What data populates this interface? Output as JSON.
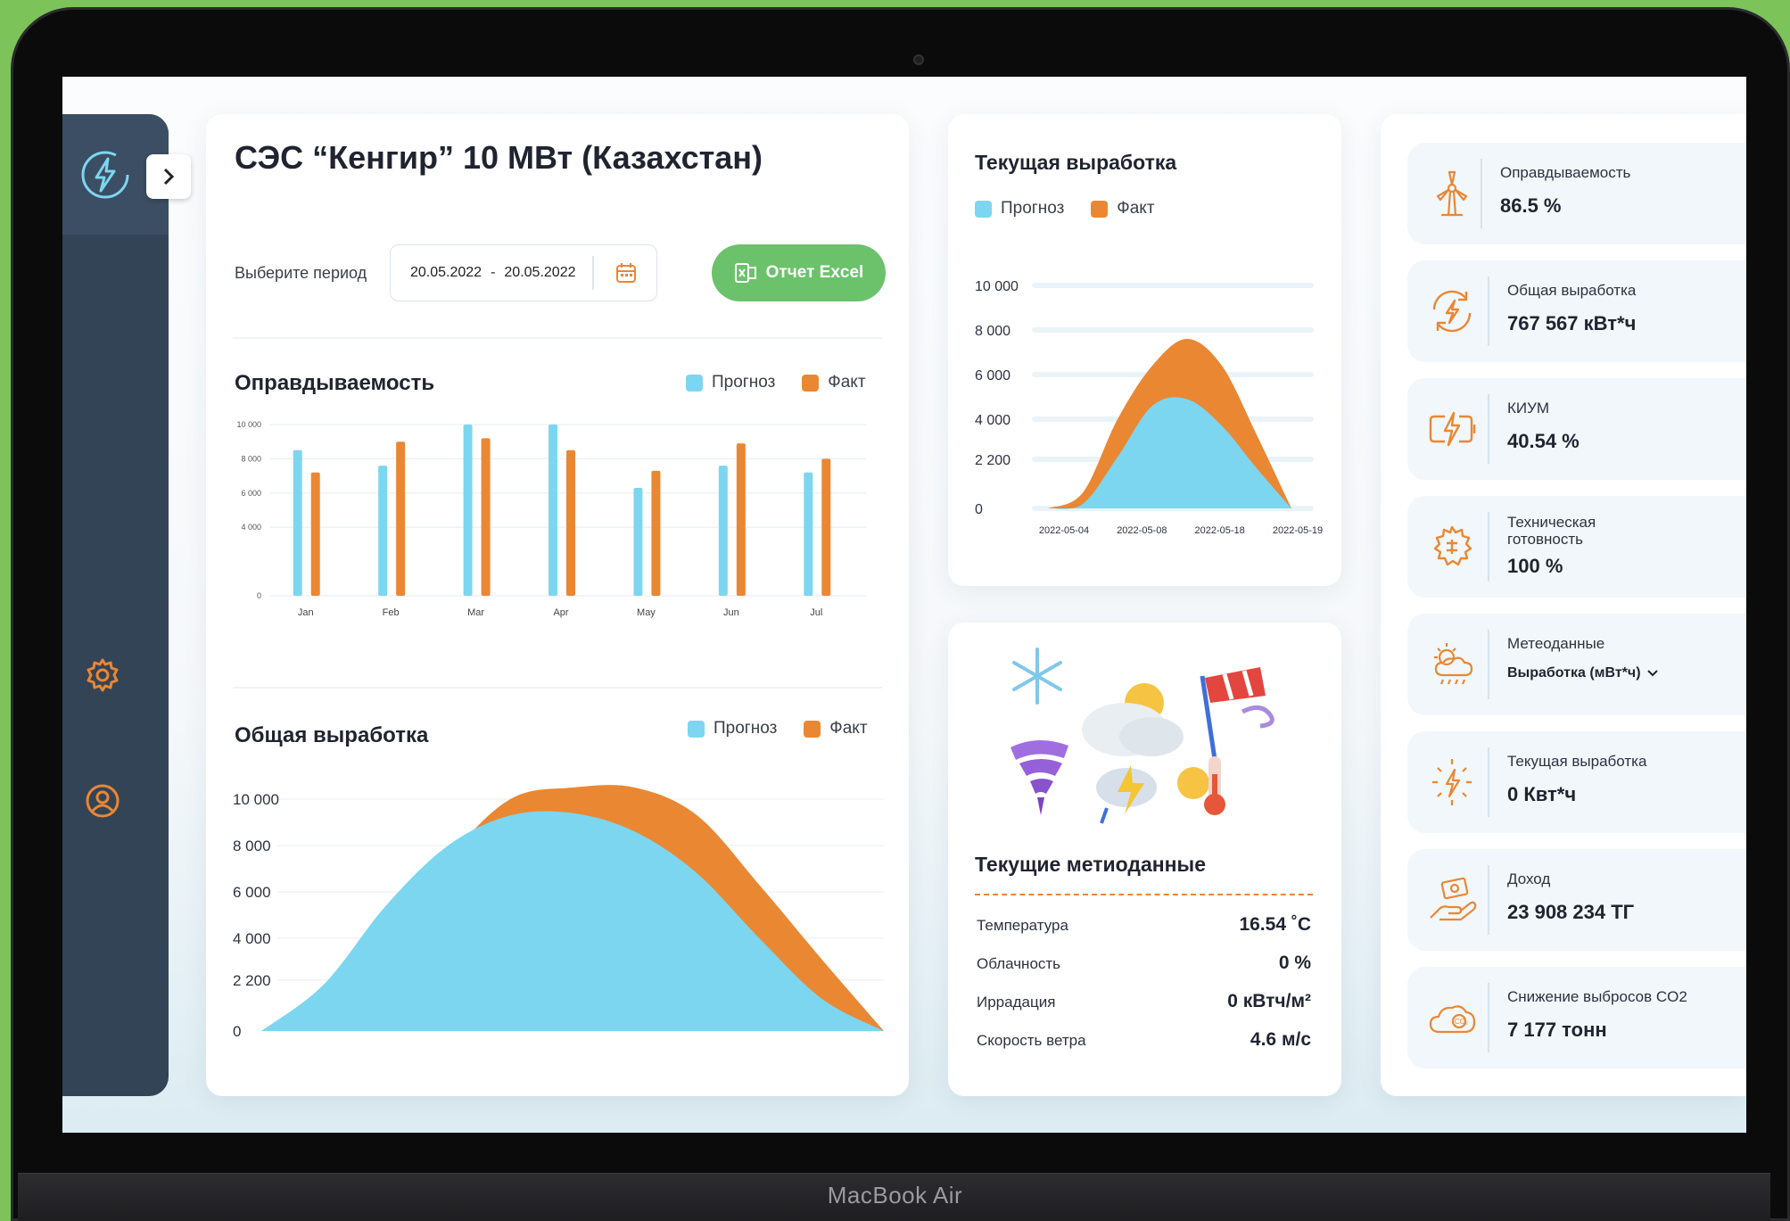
{
  "device": {
    "brand": "MacBook Air"
  },
  "header": {
    "title": "СЭС “Кенгир” 10 МВт (Казахстан)",
    "period_label": "Выберите период",
    "date_from": "20.05.2022",
    "date_sep": "-",
    "date_to": "20.05.2022",
    "excel_button": "Отчет Excel"
  },
  "legend": {
    "forecast": "Прогноз",
    "fact": "Факт"
  },
  "colors": {
    "forecast": "#7cd6f0",
    "fact": "#ea8733",
    "sidebar": "#344457",
    "accent": "#ea8733",
    "excel": "#6bc26b"
  },
  "sidebar": {
    "icons": [
      "lightning-logo-icon",
      "chevron-right-icon",
      "gear-icon",
      "user-icon"
    ]
  },
  "chart_data": [
    {
      "type": "bar",
      "title": "Оправдываемость",
      "categories": [
        "Jan",
        "Feb",
        "Mar",
        "Apr",
        "May",
        "Jun",
        "Jul"
      ],
      "y_ticks": [
        "0",
        "4 000",
        "6 000",
        "8 000",
        "10 000"
      ],
      "ylim": [
        0,
        10000
      ],
      "series": [
        {
          "name": "Прогноз",
          "values": [
            8500,
            7600,
            10000,
            10000,
            6300,
            7600,
            7200
          ]
        },
        {
          "name": "Факт",
          "values": [
            7200,
            9000,
            9200,
            8500,
            7300,
            8900,
            8000
          ]
        }
      ]
    },
    {
      "type": "area",
      "title": "Общая выработка",
      "y_ticks": [
        "0",
        "2 200",
        "4 000",
        "6 000",
        "8 000",
        "10 000"
      ],
      "series": [
        {
          "name": "Прогноз",
          "values": [
            0,
            2000,
            5400,
            8000,
            9300,
            9400,
            8600,
            6800,
            4000,
            1400,
            0
          ]
        },
        {
          "name": "Факт",
          "values": [
            0,
            1200,
            3600,
            7400,
            10000,
            10500,
            10500,
            9300,
            6300,
            3100,
            0
          ]
        }
      ]
    },
    {
      "type": "area",
      "title": "Текущая выработка",
      "categories": [
        "2022-05-04",
        "2022-05-08",
        "2022-05-18",
        "2022-05-19"
      ],
      "y_ticks": [
        "0",
        "2 200",
        "4 000",
        "6 000",
        "8 000",
        "10 000"
      ],
      "series": [
        {
          "name": "Прогноз",
          "values": [
            0,
            200,
            2300,
            4600,
            4900,
            3700,
            1800,
            0
          ]
        },
        {
          "name": "Факт",
          "values": [
            0,
            700,
            4000,
            6400,
            7600,
            6400,
            3300,
            0
          ]
        }
      ]
    }
  ],
  "meteo": {
    "title": "Текущие метиоданные",
    "rows": [
      {
        "label": "Температура",
        "value": "16.54 ˚C"
      },
      {
        "label": "Облачность",
        "value": "0 %"
      },
      {
        "label": "Иррадация",
        "value": "0 кВтч/м²"
      },
      {
        "label": "Скорость ветра",
        "value": "4.6 м/с"
      }
    ]
  },
  "stats": [
    {
      "label": "Оправдываемость",
      "value": "86.5 %",
      "icon": "wind-turbine-icon"
    },
    {
      "label": "Общая выработка",
      "value": "767 567 кВт*ч",
      "icon": "energy-cycle-icon"
    },
    {
      "label": "КИУМ",
      "value": "40.54 %",
      "icon": "battery-bolt-icon"
    },
    {
      "label": "Техническая готовность",
      "value": "100 %",
      "icon": "chip-gear-icon"
    },
    {
      "label": "Метеоданные",
      "value": "Выработка (мВт*ч)",
      "icon": "weather-icon"
    },
    {
      "label": "Текущая выработка",
      "value": "0 Квт*ч",
      "icon": "sparkle-bolt-icon"
    },
    {
      "label": "Доход",
      "value": "23 908 234 ТГ",
      "icon": "money-hand-icon"
    },
    {
      "label": "Снижение выбросов CO2",
      "value": "7 177 тонн",
      "icon": "co2-cloud-icon"
    }
  ]
}
